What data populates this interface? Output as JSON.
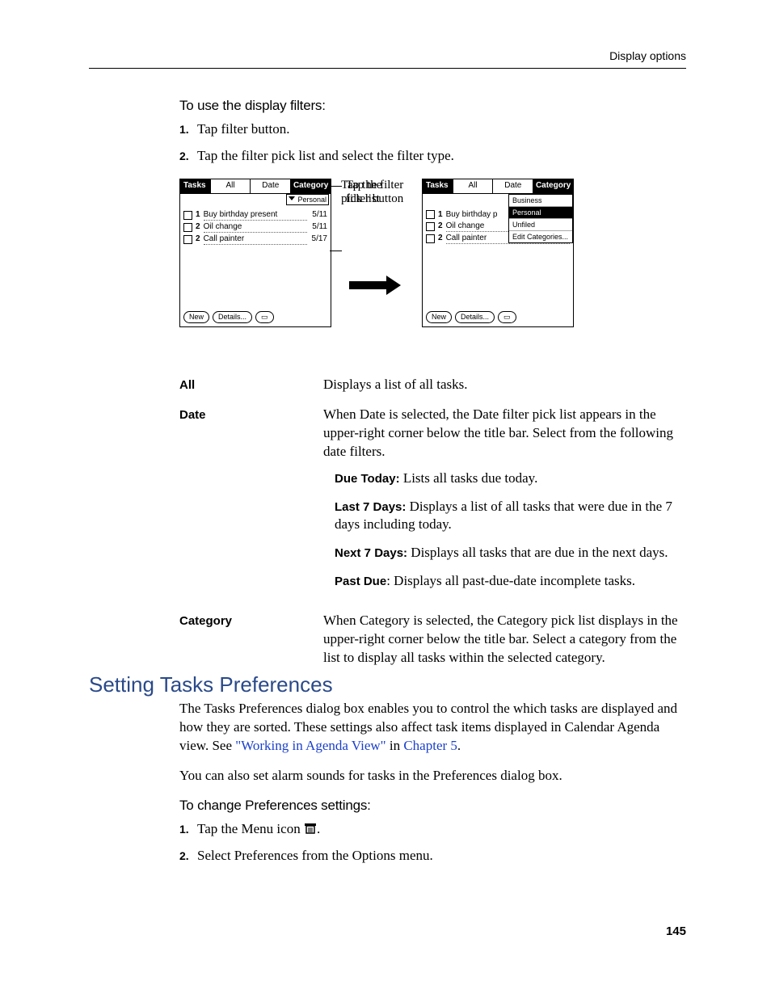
{
  "header": {
    "right": "Display options"
  },
  "subheads": {
    "filters": "To use the display filters:",
    "prefs": "To change Preferences settings:"
  },
  "steps_filters": {
    "n1": "1.",
    "t1": "Tap filter button.",
    "n2": "2.",
    "t2": "Tap the filter pick list and select the filter type."
  },
  "steps_prefs": {
    "n1": "1.",
    "t1a": "Tap the Menu icon ",
    "t1b": ".",
    "n2": "2.",
    "t2": "Select Preferences from the Options menu."
  },
  "callouts": {
    "c1a": "Tap the",
    "c1b": "filter button",
    "c2a": "Tap the filter",
    "c2b": "pick list"
  },
  "palm": {
    "title": "Tasks",
    "tabs": {
      "all": "All",
      "date": "Date",
      "category": "Category"
    },
    "sub_personal": "Personal",
    "rows": [
      {
        "pri": "1",
        "desc": "Buy birthday present",
        "date": "5/11"
      },
      {
        "pri": "2",
        "desc": "Oil change",
        "date": "5/11"
      },
      {
        "pri": "2",
        "desc": "Call painter",
        "date": "5/17"
      }
    ],
    "rows2": [
      {
        "pri": "1",
        "desc": "Buy birthday p"
      },
      {
        "pri": "2",
        "desc": "Oil change"
      },
      {
        "pri": "2",
        "desc": "Call painter"
      }
    ],
    "dropdown": [
      "Business",
      "Personal",
      "Unfiled",
      "Edit Categories..."
    ],
    "btn_new": "New",
    "btn_details": "Details...",
    "note_glyph": "▭"
  },
  "defs": {
    "all": {
      "term": "All",
      "body": "Displays a list of all tasks."
    },
    "date": {
      "term": "Date",
      "body": "When Date is selected, the Date filter pick list appears in the upper-right corner below the title bar. Select from the following date filters.",
      "sub": {
        "dt_l": "Due Today:",
        "dt_t": " Lists all tasks due today.",
        "l7_l": "Last 7 Days:",
        "l7_t": " Displays a list of all tasks that were due in the 7 days including today.",
        "n7_l": "Next 7 Days:",
        "n7_t": " Displays all tasks that are due in the next days.",
        "pd_l": "Past Due",
        "pd_t": ": Displays all past-due-date incomplete tasks."
      }
    },
    "category": {
      "term": "Category",
      "body": "When Category is selected, the Category pick list displays in the upper-right corner below the title bar. Select a category from the list to display all tasks within the selected category."
    }
  },
  "h2": "Setting Tasks Preferences",
  "paras": {
    "p1a": "The Tasks Preferences dialog box enables you to control the which tasks are displayed and how they are sorted. These settings also affect task items displayed in Calendar Agenda view. See ",
    "p1_link1": "\"Working in Agenda View\"",
    "p1b": " in ",
    "p1_link2": "Chapter 5",
    "p1c": ".",
    "p2": "You can also set alarm sounds for tasks in the Preferences dialog box."
  },
  "page_num": "145"
}
